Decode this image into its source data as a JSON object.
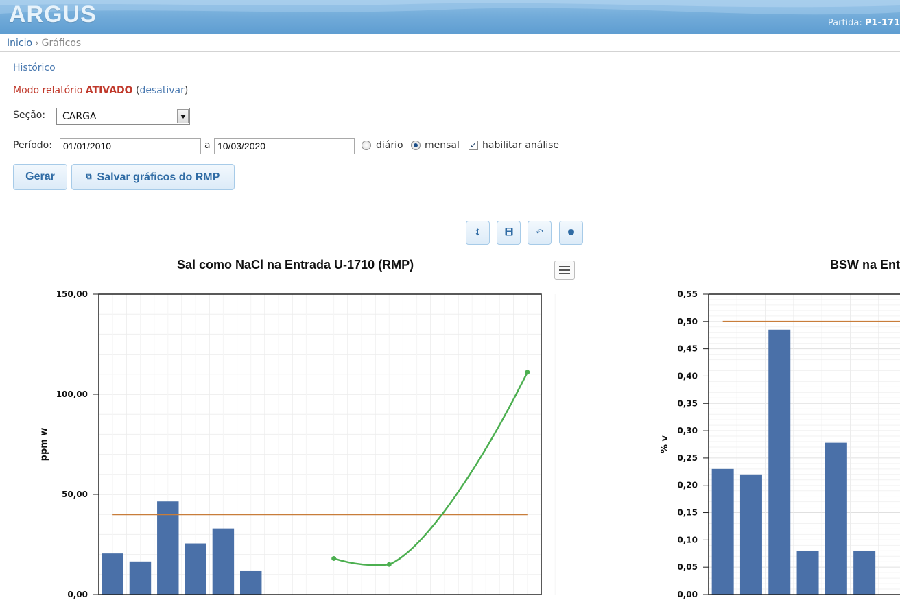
{
  "header": {
    "logo": "ARGUS",
    "partida_label": "Partida:",
    "partida_value": "P1-171"
  },
  "breadcrumb": {
    "home": "Inicio",
    "separator": "›",
    "current": "Gráficos"
  },
  "links": {
    "historico": "Histórico"
  },
  "report_mode": {
    "label": "Modo relatório",
    "state": "ATIVADO",
    "open_paren": "(",
    "toggle_link": "desativar",
    "close_paren": ")"
  },
  "form": {
    "secao_label": "Seção:",
    "secao_value": "CARGA",
    "periodo_label": "Período:",
    "date_from": "01/01/2010",
    "date_sep": "a",
    "date_to": "10/03/2020",
    "radio_diario": "diário",
    "radio_mensal": "mensal",
    "radio_selected": "mensal",
    "checkbox_label": "habilitar análise",
    "checkbox_checked": true
  },
  "buttons": {
    "gerar": "Gerar",
    "salvar": "Salvar gráficos do RMP"
  },
  "toolbar": {
    "icons": [
      "resize-icon",
      "save-icon",
      "undo-icon",
      "dot-icon"
    ]
  },
  "colors": {
    "bar": "#4a70a8",
    "limit": "#c87d3a",
    "trend": "#4caf50",
    "accent": "#2f6ba4",
    "alert": "#c0392b"
  },
  "chart_data": [
    {
      "type": "bar",
      "title": "Sal como NaCl na Entrada U-1710 (RMP)",
      "ylabel": "ppm w",
      "ylim": [
        0,
        150
      ],
      "yticks": [
        "0,00",
        "50,00",
        "100,00",
        "150,00"
      ],
      "grid": true,
      "slots": 16,
      "values": [
        20.5,
        16.5,
        46.5,
        25.5,
        33,
        12
      ],
      "limit": 40,
      "trend": [
        {
          "x": 8.5,
          "y": 18
        },
        {
          "x": 10.5,
          "y": 15
        },
        {
          "x": 15.5,
          "y": 111
        }
      ]
    },
    {
      "type": "bar",
      "title": "BSW na Ent",
      "ylabel": "% v",
      "ylim": [
        0,
        0.55
      ],
      "yticks": [
        "0,00",
        "0,05",
        "0,10",
        "0,15",
        "0,20",
        "0,25",
        "0,30",
        "0,35",
        "0,40",
        "0,45",
        "0,50",
        "0,55"
      ],
      "grid": true,
      "values": [
        0.23,
        0.22,
        0.485,
        0.08,
        0.278,
        0.08
      ],
      "limit": 0.5
    }
  ]
}
